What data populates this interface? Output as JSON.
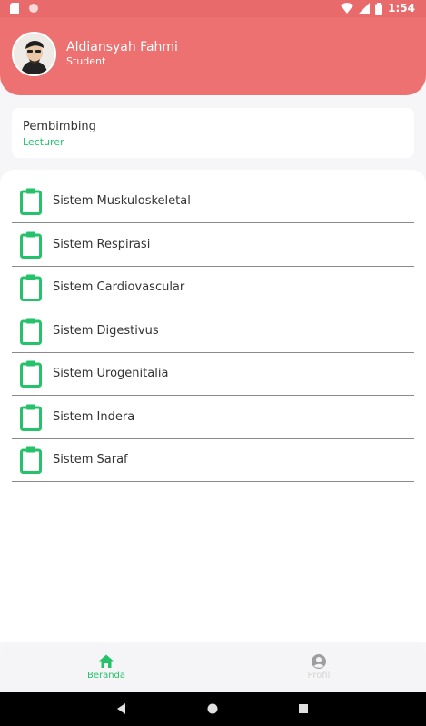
{
  "status_bar": {
    "time": "1:54"
  },
  "user": {
    "name": "Aldiansyah Fahmi",
    "role": "Student"
  },
  "advisor": {
    "label": "Pembimbing",
    "role": "Lecturer"
  },
  "menu": {
    "items": [
      {
        "label": "Sistem Muskuloskeletal",
        "icon": "clipboard-icon"
      },
      {
        "label": "Sistem Respirasi",
        "icon": "clipboard-icon"
      },
      {
        "label": "Sistem Cardiovascular",
        "icon": "clipboard-icon"
      },
      {
        "label": "Sistem Digestivus",
        "icon": "clipboard-icon"
      },
      {
        "label": "Sistem Urogenitalia",
        "icon": "clipboard-icon"
      },
      {
        "label": "Sistem Indera",
        "icon": "clipboard-icon"
      },
      {
        "label": "Sistem Saraf",
        "icon": "clipboard-icon"
      }
    ]
  },
  "bottom_nav": {
    "home": {
      "label": "Beranda",
      "icon": "home-icon",
      "active": true
    },
    "profile": {
      "label": "Profil",
      "icon": "user-circle-icon",
      "active": false
    }
  },
  "colors": {
    "header": "#ec7170",
    "accent_green": "#25c26b",
    "inactive": "#d4d4d4"
  }
}
